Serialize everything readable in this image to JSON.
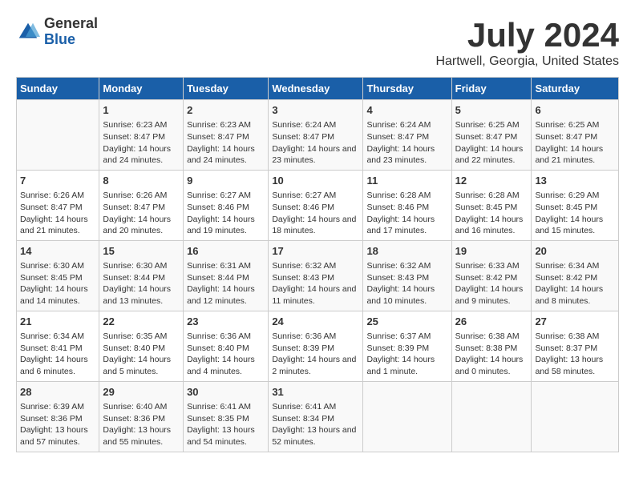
{
  "logo": {
    "general": "General",
    "blue": "Blue"
  },
  "title": "July 2024",
  "subtitle": "Hartwell, Georgia, United States",
  "headers": [
    "Sunday",
    "Monday",
    "Tuesday",
    "Wednesday",
    "Thursday",
    "Friday",
    "Saturday"
  ],
  "weeks": [
    [
      {
        "day": "",
        "sunrise": "",
        "sunset": "",
        "daylight": ""
      },
      {
        "day": "1",
        "sunrise": "Sunrise: 6:23 AM",
        "sunset": "Sunset: 8:47 PM",
        "daylight": "Daylight: 14 hours and 24 minutes."
      },
      {
        "day": "2",
        "sunrise": "Sunrise: 6:23 AM",
        "sunset": "Sunset: 8:47 PM",
        "daylight": "Daylight: 14 hours and 24 minutes."
      },
      {
        "day": "3",
        "sunrise": "Sunrise: 6:24 AM",
        "sunset": "Sunset: 8:47 PM",
        "daylight": "Daylight: 14 hours and 23 minutes."
      },
      {
        "day": "4",
        "sunrise": "Sunrise: 6:24 AM",
        "sunset": "Sunset: 8:47 PM",
        "daylight": "Daylight: 14 hours and 23 minutes."
      },
      {
        "day": "5",
        "sunrise": "Sunrise: 6:25 AM",
        "sunset": "Sunset: 8:47 PM",
        "daylight": "Daylight: 14 hours and 22 minutes."
      },
      {
        "day": "6",
        "sunrise": "Sunrise: 6:25 AM",
        "sunset": "Sunset: 8:47 PM",
        "daylight": "Daylight: 14 hours and 21 minutes."
      }
    ],
    [
      {
        "day": "7",
        "sunrise": "Sunrise: 6:26 AM",
        "sunset": "Sunset: 8:47 PM",
        "daylight": "Daylight: 14 hours and 21 minutes."
      },
      {
        "day": "8",
        "sunrise": "Sunrise: 6:26 AM",
        "sunset": "Sunset: 8:47 PM",
        "daylight": "Daylight: 14 hours and 20 minutes."
      },
      {
        "day": "9",
        "sunrise": "Sunrise: 6:27 AM",
        "sunset": "Sunset: 8:46 PM",
        "daylight": "Daylight: 14 hours and 19 minutes."
      },
      {
        "day": "10",
        "sunrise": "Sunrise: 6:27 AM",
        "sunset": "Sunset: 8:46 PM",
        "daylight": "Daylight: 14 hours and 18 minutes."
      },
      {
        "day": "11",
        "sunrise": "Sunrise: 6:28 AM",
        "sunset": "Sunset: 8:46 PM",
        "daylight": "Daylight: 14 hours and 17 minutes."
      },
      {
        "day": "12",
        "sunrise": "Sunrise: 6:28 AM",
        "sunset": "Sunset: 8:45 PM",
        "daylight": "Daylight: 14 hours and 16 minutes."
      },
      {
        "day": "13",
        "sunrise": "Sunrise: 6:29 AM",
        "sunset": "Sunset: 8:45 PM",
        "daylight": "Daylight: 14 hours and 15 minutes."
      }
    ],
    [
      {
        "day": "14",
        "sunrise": "Sunrise: 6:30 AM",
        "sunset": "Sunset: 8:45 PM",
        "daylight": "Daylight: 14 hours and 14 minutes."
      },
      {
        "day": "15",
        "sunrise": "Sunrise: 6:30 AM",
        "sunset": "Sunset: 8:44 PM",
        "daylight": "Daylight: 14 hours and 13 minutes."
      },
      {
        "day": "16",
        "sunrise": "Sunrise: 6:31 AM",
        "sunset": "Sunset: 8:44 PM",
        "daylight": "Daylight: 14 hours and 12 minutes."
      },
      {
        "day": "17",
        "sunrise": "Sunrise: 6:32 AM",
        "sunset": "Sunset: 8:43 PM",
        "daylight": "Daylight: 14 hours and 11 minutes."
      },
      {
        "day": "18",
        "sunrise": "Sunrise: 6:32 AM",
        "sunset": "Sunset: 8:43 PM",
        "daylight": "Daylight: 14 hours and 10 minutes."
      },
      {
        "day": "19",
        "sunrise": "Sunrise: 6:33 AM",
        "sunset": "Sunset: 8:42 PM",
        "daylight": "Daylight: 14 hours and 9 minutes."
      },
      {
        "day": "20",
        "sunrise": "Sunrise: 6:34 AM",
        "sunset": "Sunset: 8:42 PM",
        "daylight": "Daylight: 14 hours and 8 minutes."
      }
    ],
    [
      {
        "day": "21",
        "sunrise": "Sunrise: 6:34 AM",
        "sunset": "Sunset: 8:41 PM",
        "daylight": "Daylight: 14 hours and 6 minutes."
      },
      {
        "day": "22",
        "sunrise": "Sunrise: 6:35 AM",
        "sunset": "Sunset: 8:40 PM",
        "daylight": "Daylight: 14 hours and 5 minutes."
      },
      {
        "day": "23",
        "sunrise": "Sunrise: 6:36 AM",
        "sunset": "Sunset: 8:40 PM",
        "daylight": "Daylight: 14 hours and 4 minutes."
      },
      {
        "day": "24",
        "sunrise": "Sunrise: 6:36 AM",
        "sunset": "Sunset: 8:39 PM",
        "daylight": "Daylight: 14 hours and 2 minutes."
      },
      {
        "day": "25",
        "sunrise": "Sunrise: 6:37 AM",
        "sunset": "Sunset: 8:39 PM",
        "daylight": "Daylight: 14 hours and 1 minute."
      },
      {
        "day": "26",
        "sunrise": "Sunrise: 6:38 AM",
        "sunset": "Sunset: 8:38 PM",
        "daylight": "Daylight: 14 hours and 0 minutes."
      },
      {
        "day": "27",
        "sunrise": "Sunrise: 6:38 AM",
        "sunset": "Sunset: 8:37 PM",
        "daylight": "Daylight: 13 hours and 58 minutes."
      }
    ],
    [
      {
        "day": "28",
        "sunrise": "Sunrise: 6:39 AM",
        "sunset": "Sunset: 8:36 PM",
        "daylight": "Daylight: 13 hours and 57 minutes."
      },
      {
        "day": "29",
        "sunrise": "Sunrise: 6:40 AM",
        "sunset": "Sunset: 8:36 PM",
        "daylight": "Daylight: 13 hours and 55 minutes."
      },
      {
        "day": "30",
        "sunrise": "Sunrise: 6:41 AM",
        "sunset": "Sunset: 8:35 PM",
        "daylight": "Daylight: 13 hours and 54 minutes."
      },
      {
        "day": "31",
        "sunrise": "Sunrise: 6:41 AM",
        "sunset": "Sunset: 8:34 PM",
        "daylight": "Daylight: 13 hours and 52 minutes."
      },
      {
        "day": "",
        "sunrise": "",
        "sunset": "",
        "daylight": ""
      },
      {
        "day": "",
        "sunrise": "",
        "sunset": "",
        "daylight": ""
      },
      {
        "day": "",
        "sunrise": "",
        "sunset": "",
        "daylight": ""
      }
    ]
  ]
}
